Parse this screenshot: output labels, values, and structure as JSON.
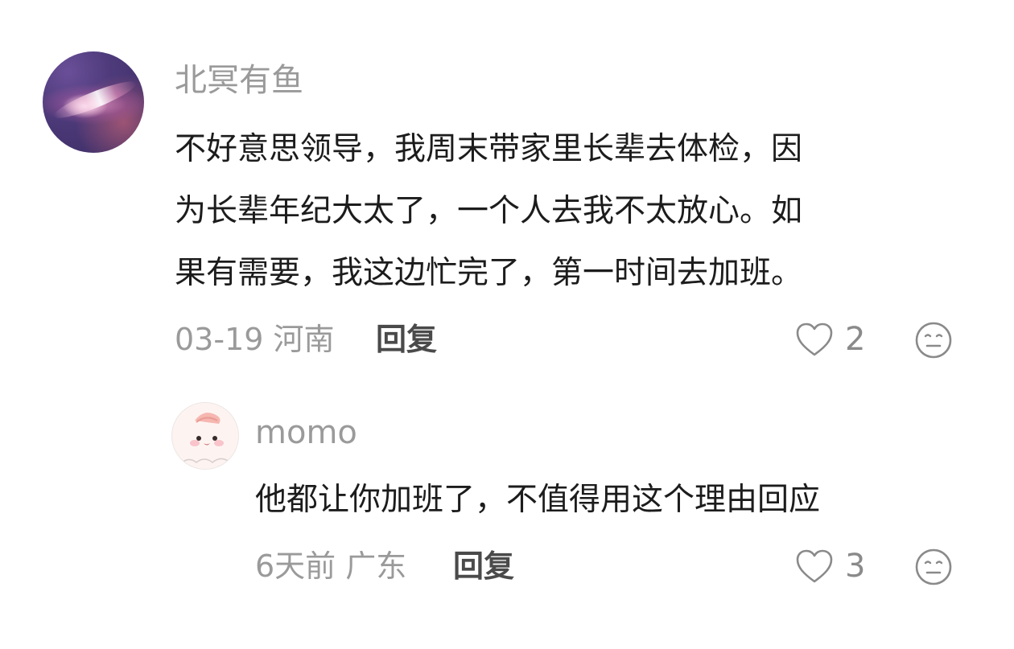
{
  "comments": [
    {
      "username": "北冥有鱼",
      "text_lines": [
        "不好意思领导，我周末带家里长辈去体检，因",
        "为长辈年纪大太了，一个人去我不太放心。如",
        "果有需要，我这边忙完了，第一时间去加班。"
      ],
      "meta": "03-19 河南",
      "reply_label": "回复",
      "likes": "2",
      "avatar_icon": "galaxy-avatar"
    },
    {
      "username": "momo",
      "text_lines": [
        "他都让你加班了，不值得用这个理由回应"
      ],
      "meta": "6天前 广东",
      "reply_label": "回复",
      "likes": "3",
      "avatar_icon": "cartoon-face-avatar"
    }
  ],
  "icons": {
    "like": "heart-outline-icon",
    "dislike": "neutral-face-icon"
  },
  "colors": {
    "muted_text": "#9a9a9a",
    "body_text": "#1c1c1c",
    "reply_text": "#4a4a4a",
    "icon_stroke": "#8a8a8a"
  }
}
